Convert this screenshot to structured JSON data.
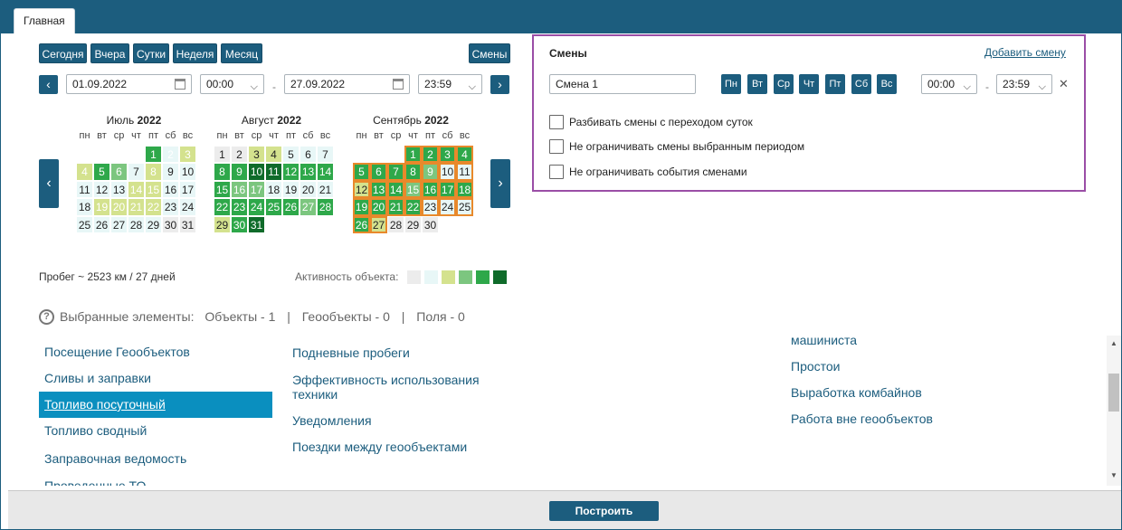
{
  "tab_label": "Главная",
  "periods": [
    "Сегодня",
    "Вчера",
    "Сутки",
    "Неделя",
    "Месяц"
  ],
  "shifts_button": "Смены",
  "date_from": "01.09.2022",
  "time_from": "00:00",
  "date_to": "27.09.2022",
  "time_to": "23:59",
  "range_dash": "-",
  "weekdays": [
    "пн",
    "вт",
    "ср",
    "чт",
    "пт",
    "сб",
    "вс"
  ],
  "months": [
    {
      "name": "Июль",
      "year": "2022",
      "offset": 4,
      "days": 31,
      "color": [
        "",
        "",
        "",
        "",
        "",
        "",
        "",
        "",
        "",
        "",
        "",
        "",
        "",
        "",
        "",
        "",
        "",
        "",
        "",
        "",
        "",
        "",
        "",
        "",
        "",
        "",
        "",
        "",
        "",
        "",
        ""
      ]
    },
    {
      "name": "Август",
      "year": "2022",
      "offset": 0,
      "days": 31
    },
    {
      "name": "Сентябрь",
      "year": "2022",
      "offset": 3,
      "days": 30
    }
  ],
  "mileage": "Пробег ~ 2523 км / 27 дней",
  "activity_label": "Активность объекта:",
  "activity_colors": [
    "#ececec",
    "#e8f7f7",
    "#d4e28e",
    "#7cc67f",
    "#2ea84a",
    "#0f6b2a"
  ],
  "selected": {
    "prefix": "Выбранные элементы:",
    "objects": "Объекты - 1",
    "geo": "Геообъекты - 0",
    "fields": "Поля - 0",
    "sep": "|"
  },
  "reports_col1": [
    "Посещение Геообъектов",
    "Сливы и заправки",
    "Топливо посуточный",
    "Топливо сводный",
    "Заправочная ведомость",
    "Проведенные ТО"
  ],
  "reports_col2": [
    "Подневные пробеги",
    "Эффективность использования техники",
    "Уведомления",
    "Поездки между геообъектами"
  ],
  "reports_col3": [
    "машиниста",
    "Простои",
    "Выработка комбайнов",
    "Работа вне геообъектов"
  ],
  "shift_panel": {
    "title": "Смены",
    "add": "Добавить смену",
    "name": "Смена 1",
    "days": [
      "Пн",
      "Вт",
      "Ср",
      "Чт",
      "Пт",
      "Сб",
      "Вс"
    ],
    "from": "00:00",
    "to": "23:59",
    "dash": "-",
    "close": "✕",
    "options": [
      "Разбивать смены с переходом суток",
      "Не ограничивать смены выбранным периодом",
      "Не ограничивать события сменами"
    ]
  },
  "build_button": "Построить"
}
